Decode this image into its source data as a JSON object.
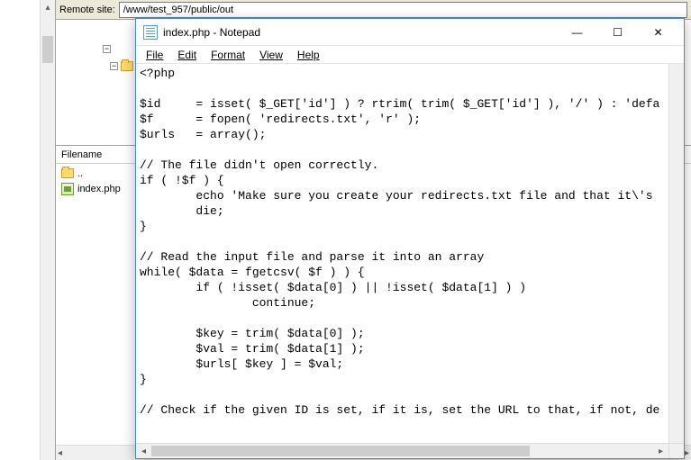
{
  "ftp": {
    "remote_label": "Remote site:",
    "remote_path": "/www/test_957/public/out",
    "filename_header": "Filename",
    "file_list": [
      {
        "name": "..",
        "type": "parent"
      },
      {
        "name": "index.php",
        "type": "php"
      }
    ]
  },
  "notepad": {
    "title": "index.php - Notepad",
    "menu": {
      "file": "File",
      "edit": "Edit",
      "format": "Format",
      "view": "View",
      "help": "Help"
    },
    "win": {
      "min": "—",
      "max": "☐",
      "close": "✕"
    },
    "code_lines": [
      "<?php",
      "",
      "$id     = isset( $_GET['id'] ) ? rtrim( trim( $_GET['id'] ), '/' ) : 'defa",
      "$f      = fopen( 'redirects.txt', 'r' );",
      "$urls   = array();",
      "",
      "// The file didn't open correctly.",
      "if ( !$f ) {",
      "        echo 'Make sure you create your redirects.txt file and that it\\'s ",
      "        die;",
      "}",
      "",
      "// Read the input file and parse it into an array",
      "while( $data = fgetcsv( $f ) ) {",
      "        if ( !isset( $data[0] ) || !isset( $data[1] ) )",
      "                continue;",
      "",
      "        $key = trim( $data[0] );",
      "        $val = trim( $data[1] );",
      "        $urls[ $key ] = $val;",
      "}",
      "",
      "// Check if the given ID is set, if it is, set the URL to that, if not, de",
      ""
    ]
  }
}
